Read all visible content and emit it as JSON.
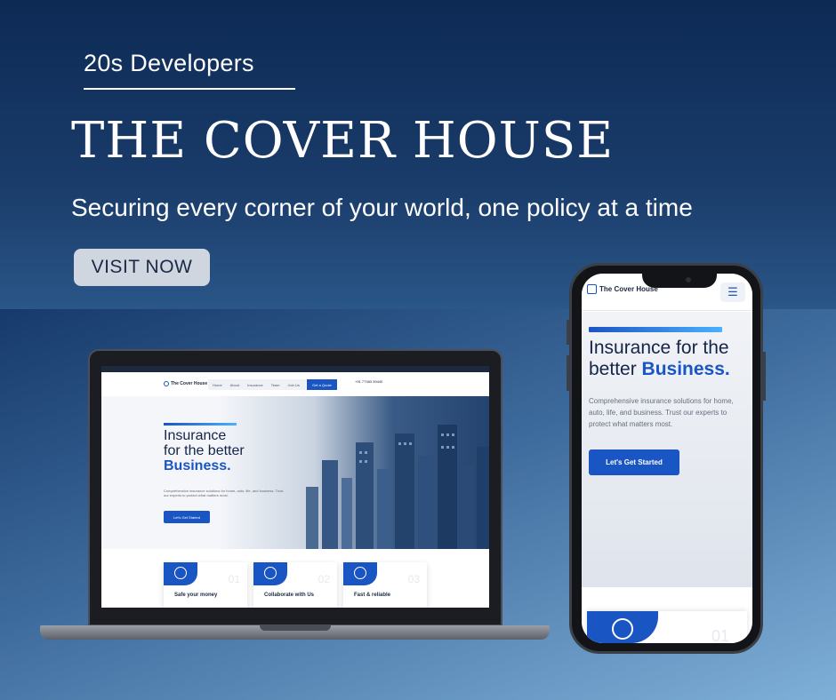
{
  "brand": {
    "subtitle": "20s Developers"
  },
  "hero": {
    "title": "THE COVER HOUSE",
    "tagline": "Securing every corner of your world, one policy at a time",
    "cta_label": "VISIT NOW"
  },
  "laptop_site": {
    "logo_text": "The Cover House",
    "menu": [
      "Home",
      "About",
      "Insurance",
      "Team",
      "Join Us"
    ],
    "quote_button": "Get a Quote",
    "phone_text": "+91 77383 39440",
    "headline_line1": "Insurance",
    "headline_line2": "for the better",
    "headline_highlight": "Business.",
    "description": "Comprehensive insurance solutions for home, auto, life, and business. Trust our experts to protect what matters most.",
    "cta": "Let's Get Started",
    "cards": [
      {
        "title": "Safe your money",
        "number": "01"
      },
      {
        "title": "Collaborate with Us",
        "number": "02"
      },
      {
        "title": "Fast & reliable",
        "number": "03"
      }
    ]
  },
  "phone_site": {
    "logo_text": "The Cover House",
    "menu_icon": "hamburger-icon",
    "headline_line1": "Insurance for the",
    "headline_line2": "better",
    "headline_highlight": "Business.",
    "description": "Comprehensive insurance solutions for home, auto, life, and business. Trust our experts to protect what matters most.",
    "cta": "Let's Get Started",
    "card_number": "01"
  },
  "colors": {
    "accent": "#1a55c4",
    "background_top": "#0d2a55",
    "background_bottom": "#7fb0d8"
  }
}
